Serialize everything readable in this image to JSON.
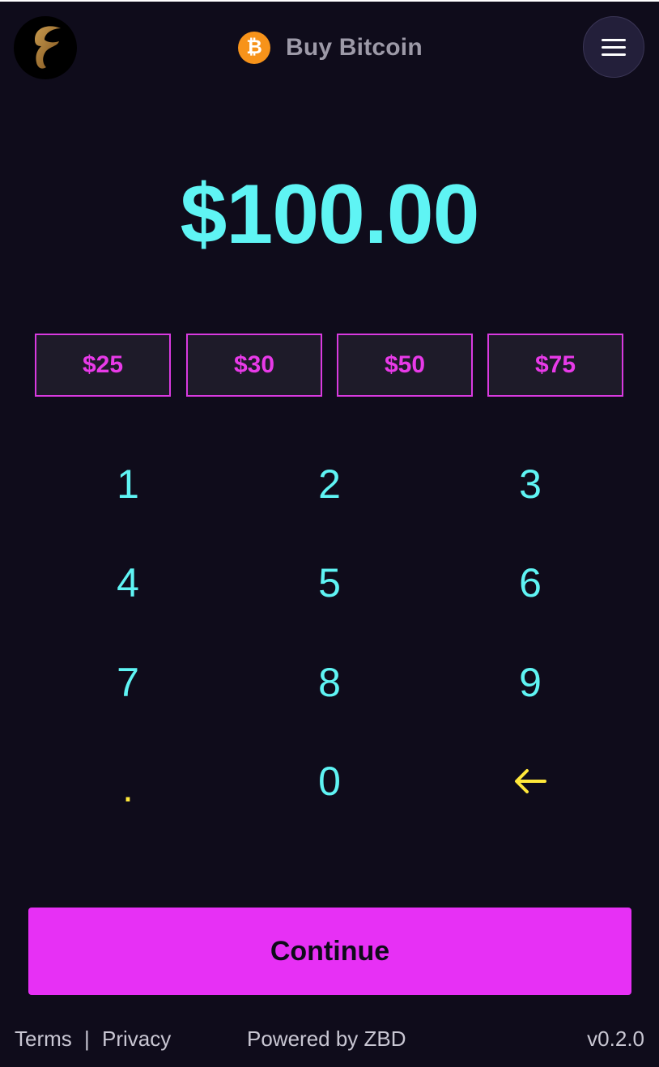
{
  "header": {
    "title": "Buy Bitcoin",
    "logo_icon": "fountain-logo-icon",
    "currency_icon": "bitcoin-icon",
    "currency_glyph": "₿",
    "menu_icon": "hamburger-menu-icon"
  },
  "amount": {
    "value": "$100.00"
  },
  "presets": [
    {
      "label": "$25"
    },
    {
      "label": "$30"
    },
    {
      "label": "$50"
    },
    {
      "label": "$75"
    }
  ],
  "keypad": {
    "keys": [
      "1",
      "2",
      "3",
      "4",
      "5",
      "6",
      "7",
      "8",
      "9",
      ".",
      "0"
    ],
    "backspace_icon": "arrow-left-icon"
  },
  "actions": {
    "continue_label": "Continue"
  },
  "footer": {
    "terms": "Terms",
    "separator": "|",
    "privacy": "Privacy",
    "powered_by": "Powered by ZBD",
    "version": "v0.2.0"
  },
  "colors": {
    "background": "#0f0c1b",
    "accent_cyan": "#5ff4f4",
    "accent_magenta": "#e730f5",
    "accent_yellow": "#ffe83a",
    "bitcoin_orange": "#f7931a"
  }
}
